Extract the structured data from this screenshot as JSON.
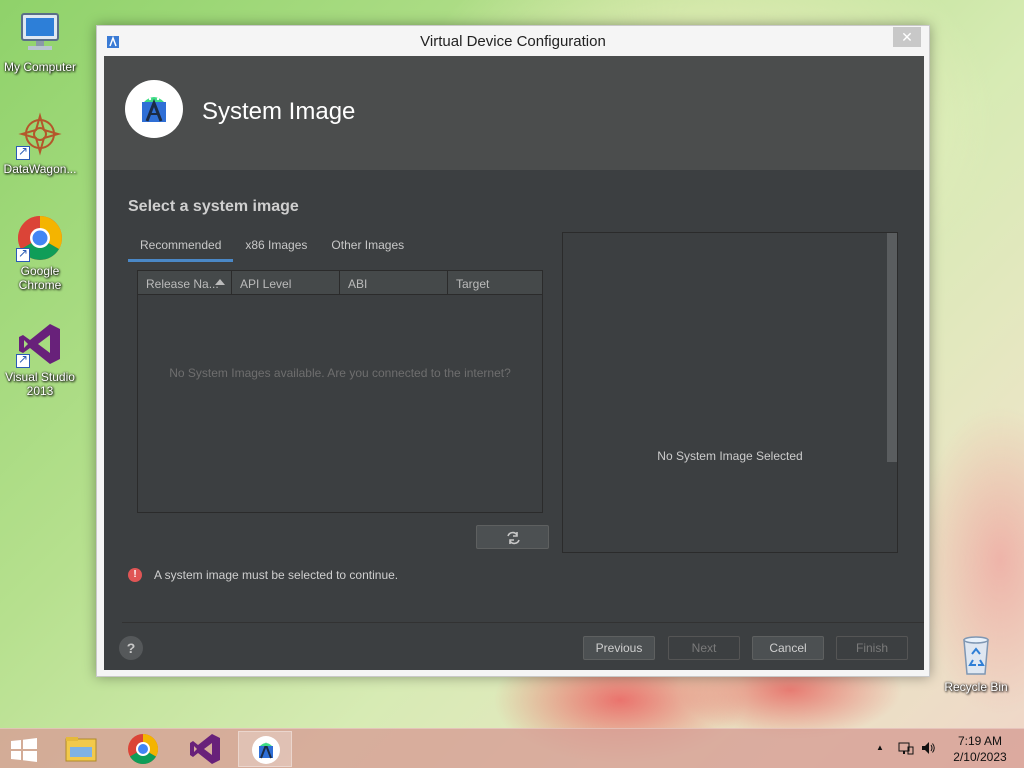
{
  "desktop": {
    "icons": [
      {
        "label": "My Computer"
      },
      {
        "label": "DataWagon..."
      },
      {
        "label": "Google Chrome"
      },
      {
        "label": "Visual Studio 2013"
      },
      {
        "label": "Recycle Bin"
      }
    ]
  },
  "window": {
    "title": "Virtual Device Configuration",
    "close_glyph": "✕",
    "header_title": "System Image",
    "section_title": "Select a system image",
    "tabs": [
      {
        "label": "Recommended",
        "active": true
      },
      {
        "label": "x86 Images",
        "active": false
      },
      {
        "label": "Other Images",
        "active": false
      }
    ],
    "table": {
      "columns": [
        "Release Na...",
        "API Level",
        "ABI",
        "Target"
      ],
      "sorted_column": "Release Na...",
      "empty_message": "No System Images available. Are you connected to the internet?"
    },
    "refresh_icon": "refresh-icon",
    "details_message": "No System Image Selected",
    "error_message": "A system image must be selected to continue.",
    "help_glyph": "?",
    "buttons": {
      "previous": "Previous",
      "next": "Next",
      "cancel": "Cancel",
      "finish": "Finish"
    }
  },
  "taskbar": {
    "items": [
      "file-explorer-icon",
      "chrome-icon",
      "visual-studio-icon",
      "android-studio-icon"
    ],
    "tray_arrow": "▲",
    "time": "7:19 AM",
    "date": "2/10/2023"
  },
  "colors": {
    "dialog_bg": "#3c3f41",
    "header_bg": "#4b4d4d",
    "tab_accent": "#4a88c7",
    "error": "#e05555"
  }
}
